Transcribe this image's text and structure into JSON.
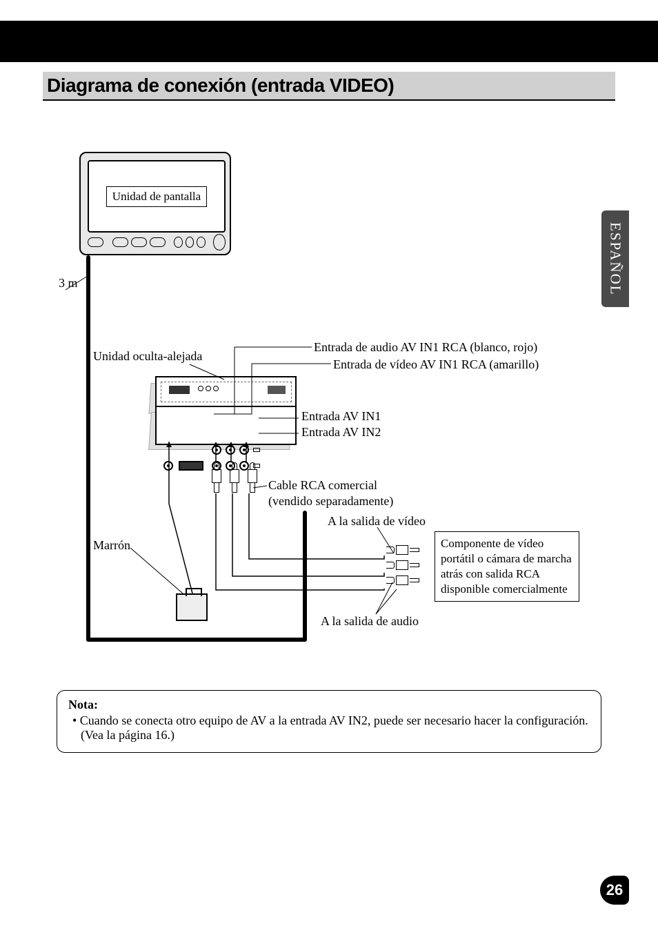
{
  "section_title": "Diagrama de conexión (entrada VIDEO)",
  "side_tab": "ESPAÑOL",
  "page_number": "26",
  "diagram": {
    "display_unit_label": "Unidad de pantalla",
    "cable_length": "3 m",
    "hideaway_label": "Unidad oculta-alejada",
    "audio_in1_label": "Entrada de audio AV IN1 RCA (blanco, rojo)",
    "video_in1_label": "Entrada de vídeo AV IN1 RCA (amarillo)",
    "av_in1_label": "Entrada AV IN1",
    "av_in2_label": "Entrada AV IN2",
    "rca_cable_label_line1": "Cable RCA comercial",
    "rca_cable_label_line2": "(vendido separadamente)",
    "to_video_out": "A la salida de vídeo",
    "to_audio_out": "A la salida de audio",
    "brown_label": "Marrón",
    "component_box": "Componente de vídeo portátil o cámara de marcha atrás con salida RCA disponible comercialmente"
  },
  "note": {
    "title": "Nota:",
    "body": "• Cuando se conecta otro equipo de AV a la entrada AV IN2, puede ser necesario hacer la configuración. (Vea la página 16.)"
  }
}
